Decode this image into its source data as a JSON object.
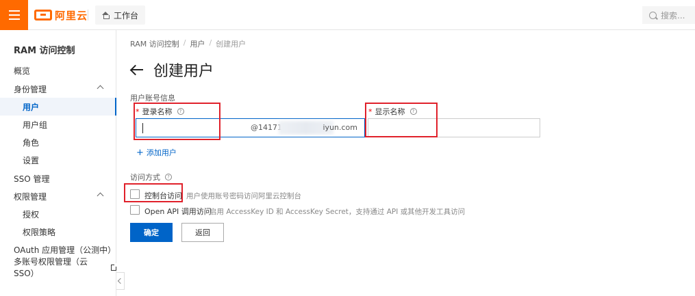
{
  "header": {
    "logo_text": "阿里云",
    "workbench_label": "工作台",
    "search_placeholder": "搜索..."
  },
  "sidebar": {
    "title": "RAM 访问控制",
    "items": [
      {
        "label": "概览"
      },
      {
        "label": "身份管理"
      },
      {
        "label": "用户"
      },
      {
        "label": "用户组"
      },
      {
        "label": "角色"
      },
      {
        "label": "设置"
      },
      {
        "label": "SSO 管理"
      },
      {
        "label": "权限管理"
      },
      {
        "label": "授权"
      },
      {
        "label": "权限策略"
      },
      {
        "label": "OAuth 应用管理（公测中）"
      },
      {
        "label": "多账号权限管理（云 SSO）"
      }
    ]
  },
  "breadcrumb": [
    "RAM 访问控制",
    "用户",
    "创建用户"
  ],
  "page": {
    "title": "创建用户"
  },
  "form": {
    "account_section": "用户账号信息",
    "login_name_label": "登录名称",
    "login_name_value": "",
    "login_name_suffix_start": "@14171",
    "login_name_suffix_end": "iyun.com",
    "display_name_label": "显示名称",
    "display_name_value": "",
    "required_mark": "*",
    "help_mark": "?",
    "add_user_label": "添加用户",
    "access_section": "访问方式",
    "console_access_label": "控制台访问",
    "console_access_desc": "用户使用账号密码访问阿里云控制台",
    "console_access_checked": false,
    "api_access_label": "Open API 调用访问",
    "api_access_desc": "启用 AccessKey ID 和 AccessKey Secret，支持通过 API 或其他开发工具访问",
    "api_access_checked": false,
    "confirm_label": "确定",
    "back_label": "返回"
  },
  "colors": {
    "brand": "#ff6a00",
    "primary": "#0064c8",
    "highlight": "#e0202a"
  }
}
